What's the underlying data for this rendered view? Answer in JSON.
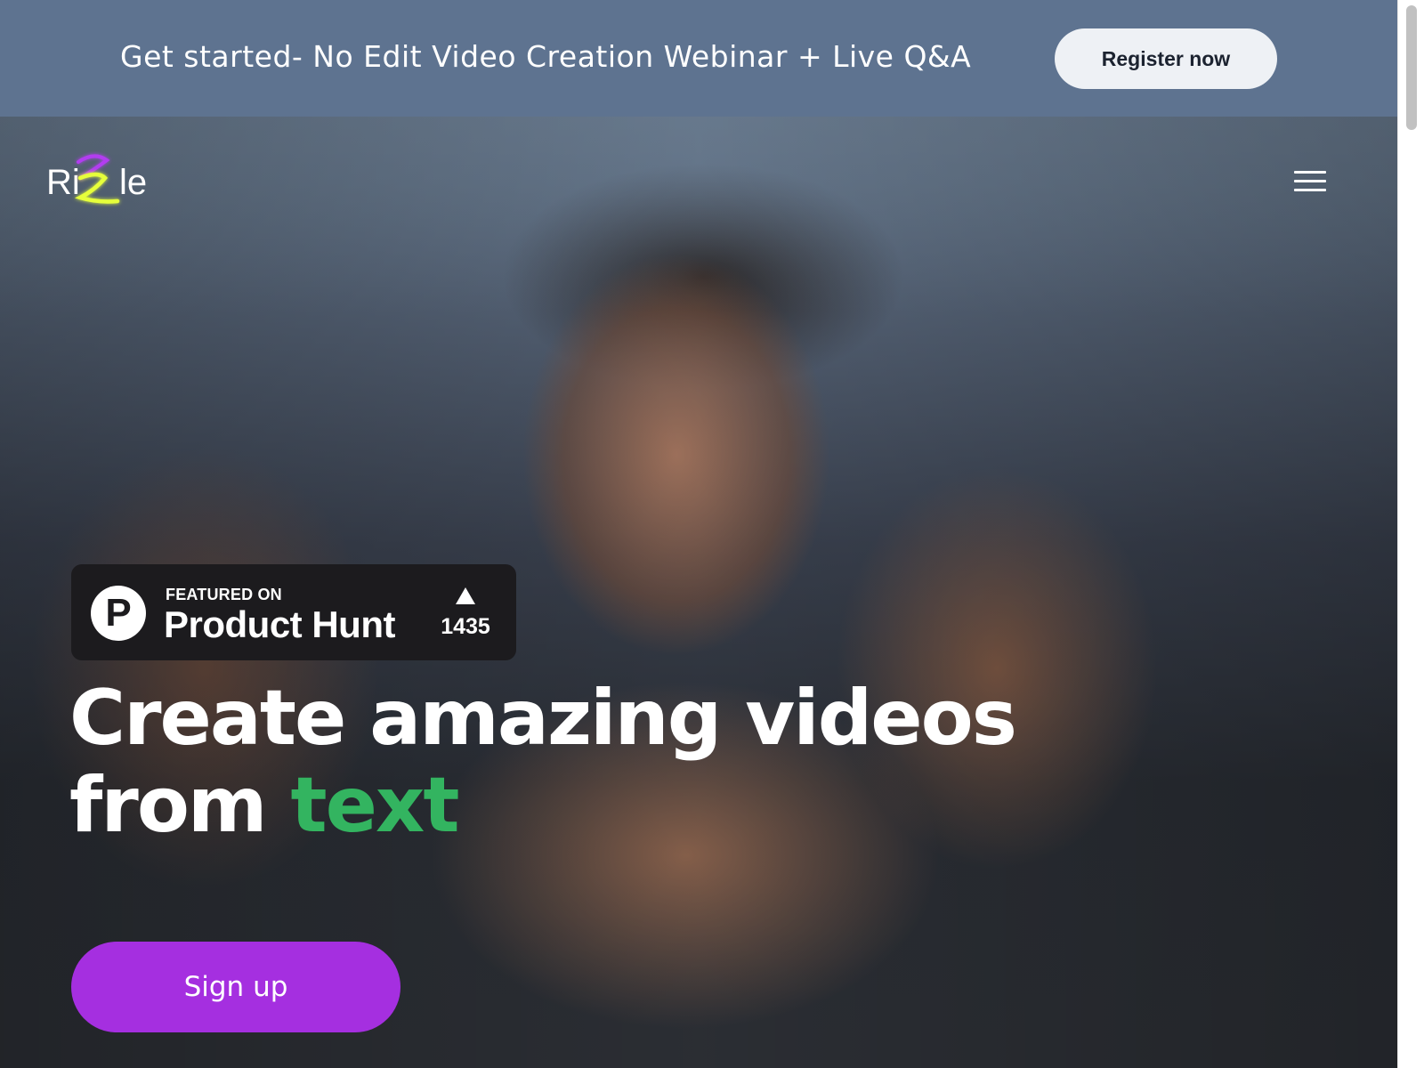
{
  "banner": {
    "text": "Get started- No Edit Video Creation Webinar + Live Q&A",
    "button_label": "Register now"
  },
  "header": {
    "logo_text": "Rizzle",
    "menu_icon": "hamburger-menu-icon"
  },
  "product_hunt": {
    "featured_label": "FEATURED ON",
    "name": "Product Hunt",
    "logo_letter": "P",
    "upvote_icon": "triangle-up-icon",
    "upvotes": "1435"
  },
  "hero": {
    "headline_line1": "Create amazing videos",
    "headline_line2_prefix": "from",
    "headline_accent": "text",
    "signup_label": "Sign up"
  },
  "colors": {
    "banner_bg": "#5e7390",
    "accent_green": "#33b460",
    "signup_purple": "#a52fe0",
    "badge_dark": "#1c1b1e"
  }
}
